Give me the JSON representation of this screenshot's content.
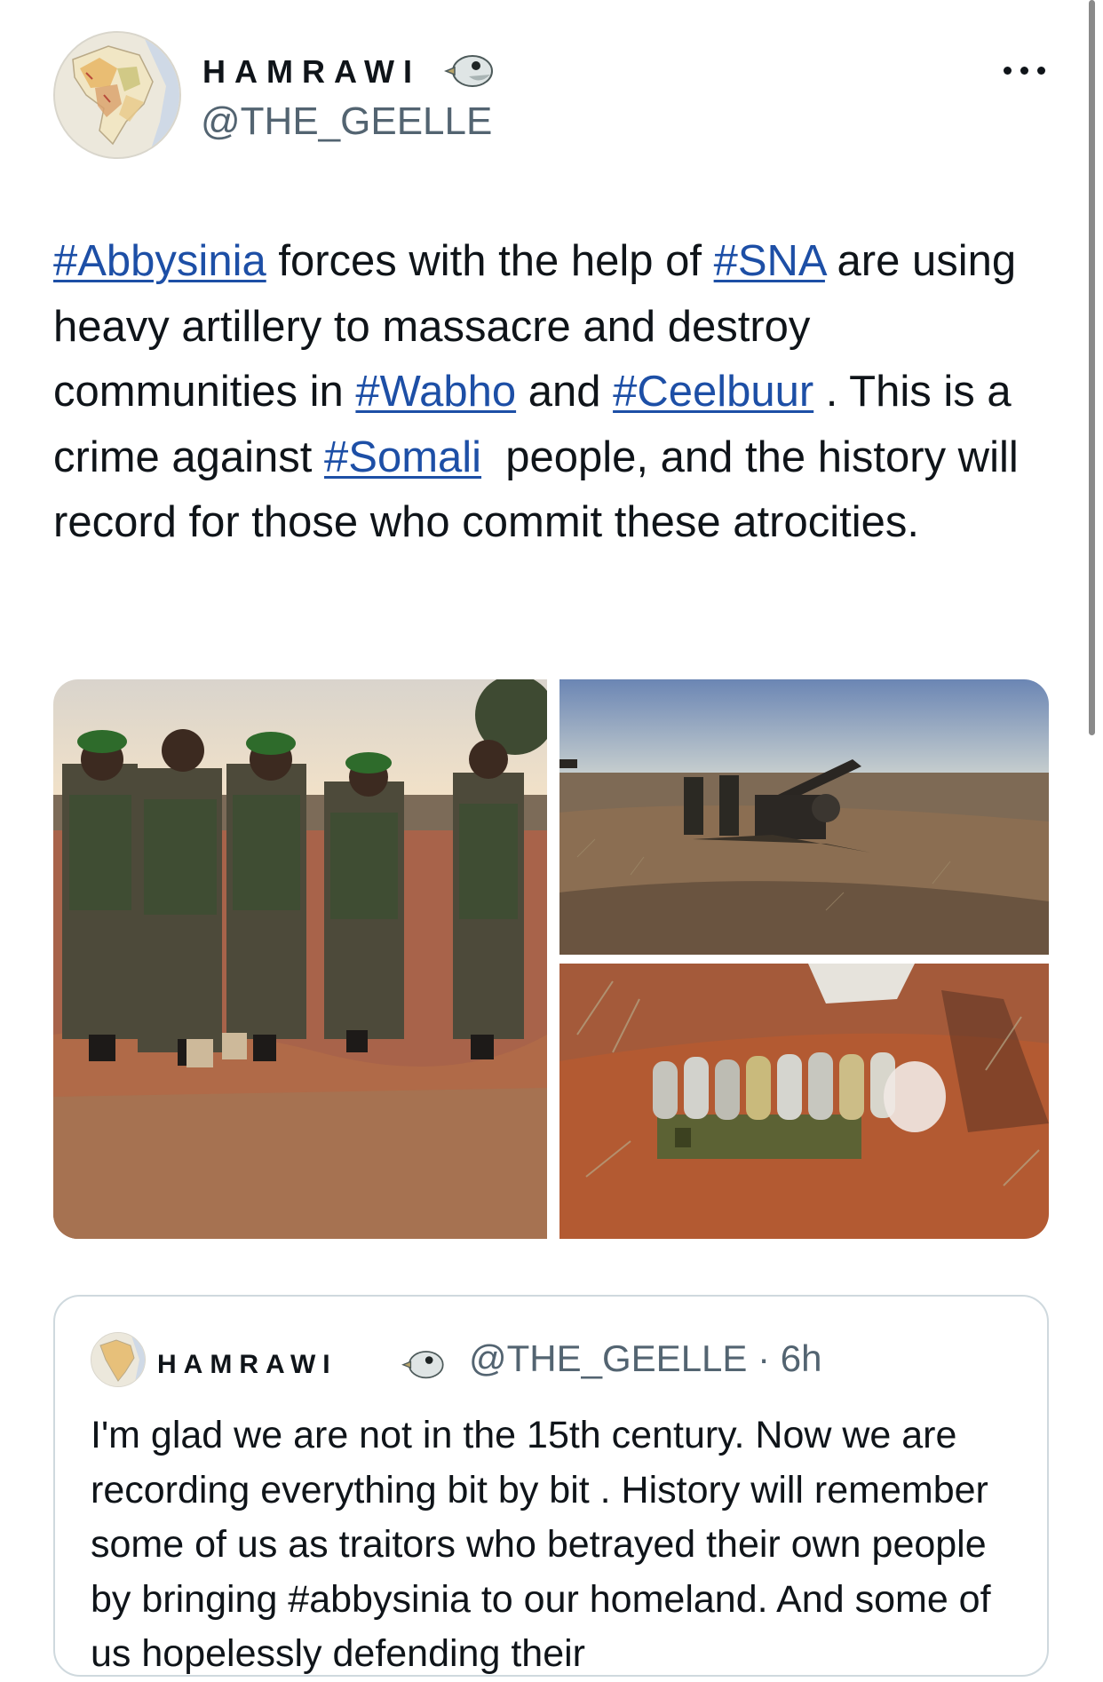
{
  "author": {
    "display_name": "HAMRAWI",
    "handle": "@THE_GEELLE",
    "avatar_icon": "map-avatar-icon",
    "badge_icon": "bird-emoji-icon"
  },
  "menu_icon": "more-options-icon",
  "tweet": {
    "segments": [
      {
        "text": "#Abbysinia",
        "link": true
      },
      {
        "text": " forces with the help of ",
        "link": false
      },
      {
        "text": "#SNA",
        "link": true
      },
      {
        "text": " are using heavy artillery to massacre and destroy communities in ",
        "link": false
      },
      {
        "text": "#Wabho",
        "link": true
      },
      {
        "text": " and ",
        "link": false
      },
      {
        "text": "#Ceelbuur",
        "link": true
      },
      {
        "text": " . This is a crime against ",
        "link": false
      },
      {
        "text": "#Somali",
        "link": true
      },
      {
        "text": "  people, and the history will record for those who commit these atrocities.",
        "link": false
      }
    ]
  },
  "media": [
    {
      "name": "photo-soldiers-group",
      "description_icon": "soldiers-photo"
    },
    {
      "name": "photo-artillery-gun",
      "description_icon": "artillery-photo"
    },
    {
      "name": "photo-artillery-shells",
      "description_icon": "shells-photo"
    }
  ],
  "quote": {
    "display_name": "HAMRAWI",
    "handle_time": "@THE_GEELLE · 6h",
    "text": "I'm glad we are not in the 15th century. Now we are recording everything bit by bit . History will remember some of us as traitors who betrayed their own people by bringing #abbysinia to our homeland. And some of us hopelessly defending their"
  },
  "colors": {
    "link": "#1d4fa6",
    "text": "#0f1419",
    "secondary": "#536471",
    "border": "#cfd9de"
  }
}
